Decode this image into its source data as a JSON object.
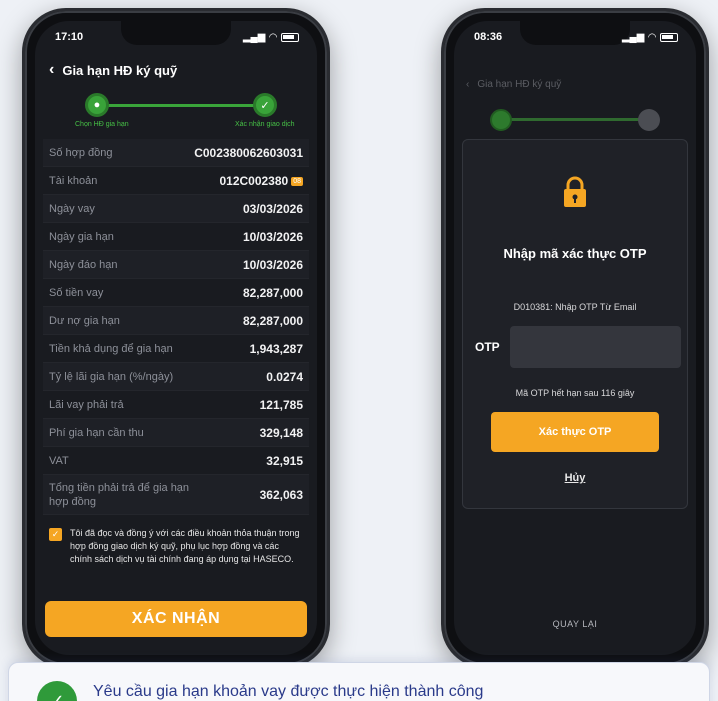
{
  "left_phone": {
    "status_time": "17:10",
    "title": "Gia hạn HĐ ký quỹ",
    "steps": [
      {
        "label": "Chọn HĐ gia hạn"
      },
      {
        "label": "Xác nhận giao dịch"
      }
    ],
    "details": [
      {
        "key": "Số hợp đồng",
        "value": "C00238006260303​1"
      },
      {
        "key": "Tài khoản",
        "value": "012C002380",
        "badge": "08"
      },
      {
        "key": "Ngày vay",
        "value": "03/03/2026"
      },
      {
        "key": "Ngày gia hạn",
        "value": "10/03/2026"
      },
      {
        "key": "Ngày đáo hạn",
        "value": "10/03/2026"
      },
      {
        "key": "Số tiền vay",
        "value": "82,287,000"
      },
      {
        "key": "Dư nợ gia hạn",
        "value": "82,287,000"
      },
      {
        "key": "Tiền khả dụng để gia hạn",
        "value": "1,943,287"
      },
      {
        "key": "Tỷ lệ lãi gia hạn (%/ngày)",
        "value": "0.0274"
      },
      {
        "key": "Lãi vay phải trả",
        "value": "121,785"
      },
      {
        "key": "Phí gia hạn cần thu",
        "value": "329,148"
      },
      {
        "key": "VAT",
        "value": "32,915"
      },
      {
        "key": "Tổng tiền phải trả để gia hạn hợp đồng",
        "value": "362,063"
      }
    ],
    "terms_text": "Tôi đã đọc và đồng ý với các điều khoản thỏa thuận trong hợp đồng giao dịch ký quỹ, phụ lục hợp đồng và các chính sách dịch vụ tài chính đang áp dụng tại HASECO.",
    "confirm_label": "XÁC NHẬN"
  },
  "right_phone": {
    "status_time": "08:36",
    "title": "Gia hạn HĐ ký quỹ",
    "otp_title": "Nhập mã xác thực OTP",
    "otp_sub": "D010381: Nhập OTP Từ Email",
    "otp_label": "OTP",
    "otp_value": "",
    "otp_expiry": "Mã OTP hết hạn sau 116 giây",
    "verify_label": "Xác thực OTP",
    "cancel_label": "Hủy",
    "back_label": "QUAY LẠI"
  },
  "toast": {
    "message": "Yêu cầu gia hạn khoản vay được thực hiện thành công"
  },
  "colors": {
    "accent": "#f5a623",
    "success": "#39a339",
    "toast_text": "#2a3a8a"
  }
}
